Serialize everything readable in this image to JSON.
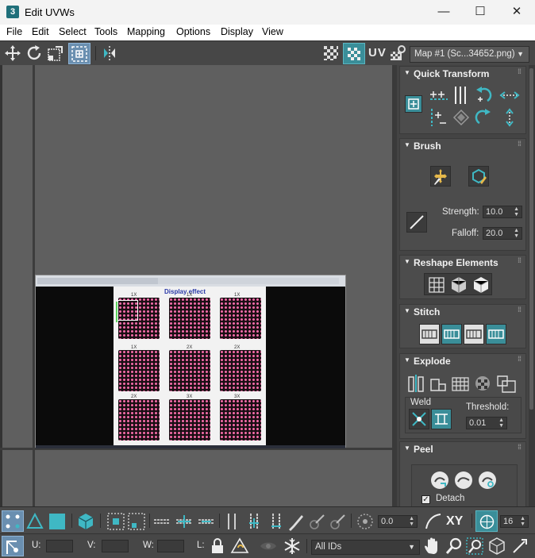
{
  "window": {
    "title": "Edit UVWs",
    "app_icon_label": "3",
    "controls": {
      "minimize": "—",
      "maximize": "☐",
      "close": "✕"
    }
  },
  "menu": [
    "File",
    "Edit",
    "Select",
    "Tools",
    "Mapping",
    "Options",
    "Display",
    "View"
  ],
  "toolbar": {
    "uv_label": "UV",
    "map_select": "Map #1 (Sc...34652.png)"
  },
  "texture": {
    "heading": "Display effect",
    "tile_labels": [
      "1X",
      "1X",
      "1X",
      "1X",
      "2X",
      "2X",
      "2X",
      "3X",
      "3X"
    ],
    "tile_text": [
      "",
      "LED 16 16",
      "Wat",
      "",
      "",
      "Car",
      "",
      "ARDUINO MATRIX",
      "I LOVE U"
    ]
  },
  "panel": {
    "quick_transform": {
      "title": "Quick Transform"
    },
    "brush": {
      "title": "Brush",
      "strength_label": "Strength:",
      "strength_value": "10.0",
      "falloff_label": "Falloff:",
      "falloff_value": "20.0"
    },
    "reshape": {
      "title": "Reshape Elements"
    },
    "stitch": {
      "title": "Stitch"
    },
    "explode": {
      "title": "Explode",
      "weld_label": "Weld",
      "threshold_label": "Threshold:",
      "threshold_value": "0.01"
    },
    "peel": {
      "title": "Peel",
      "detach_label": "Detach",
      "detach_checked": true
    }
  },
  "bottom": {
    "angle_value": "0.0",
    "xy_label": "XY",
    "pixel_snap_label": "16",
    "u_label": "U:",
    "v_label": "V:",
    "w_label": "W:",
    "l_label": "L:",
    "ids_select": "All IDs"
  },
  "colors": {
    "accent": "#3a8e99",
    "panel_bg": "#444444",
    "viewport_bg": "#5f5f5f",
    "led_pink": "#ff6fae"
  }
}
